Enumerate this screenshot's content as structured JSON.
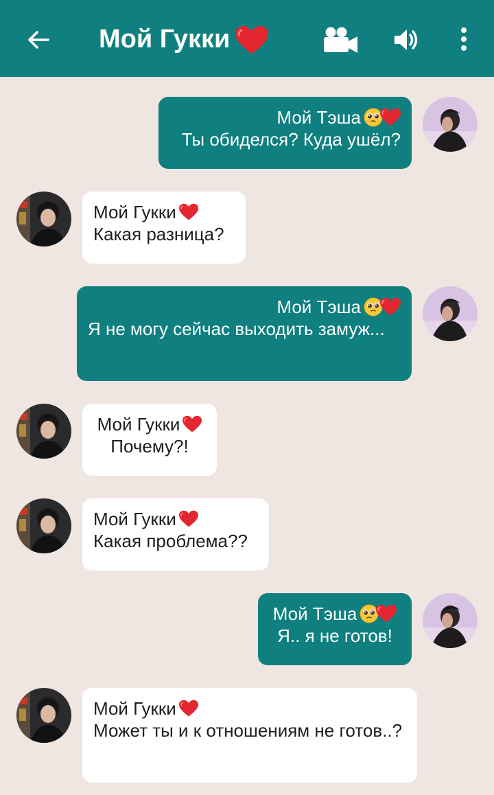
{
  "header": {
    "title": "Мой Гукки",
    "title_emoji": "red-heart",
    "icons": [
      "back-arrow-icon",
      "video-camera-icon",
      "speaker-icon",
      "more-vert-icon"
    ]
  },
  "colors": {
    "header_bg": "#0f7f7f",
    "outgoing_bubble": "#0f7f7f",
    "incoming_bubble": "#ffffff",
    "chat_bg": "#efe6e2"
  },
  "messages": [
    {
      "direction": "out",
      "sender": "Мой Тэша",
      "sender_emoji": "pleading-face + red-heart",
      "text": "Ты обиделся? Куда ушёл?"
    },
    {
      "direction": "in",
      "sender": "Мой Гукки",
      "sender_emoji": "red-heart",
      "text": "Какая разница?"
    },
    {
      "direction": "out",
      "sender": "Мой Тэша",
      "sender_emoji": "pleading-face + red-heart",
      "text": "Я не могу сейчас выходить замуж..."
    },
    {
      "direction": "in",
      "sender": "Мой Гукки",
      "sender_emoji": "red-heart",
      "text": "Почему?!"
    },
    {
      "direction": "in",
      "sender": "Мой Гукки",
      "sender_emoji": "red-heart",
      "text": "Какая проблема??"
    },
    {
      "direction": "out",
      "sender": "Мой Тэша",
      "sender_emoji": "pleading-face + red-heart",
      "text": "Я.. я не готов!"
    },
    {
      "direction": "in",
      "sender": "Мой Гукки",
      "sender_emoji": "red-heart",
      "text": "Может ты и к отношениям не готов..?"
    }
  ]
}
